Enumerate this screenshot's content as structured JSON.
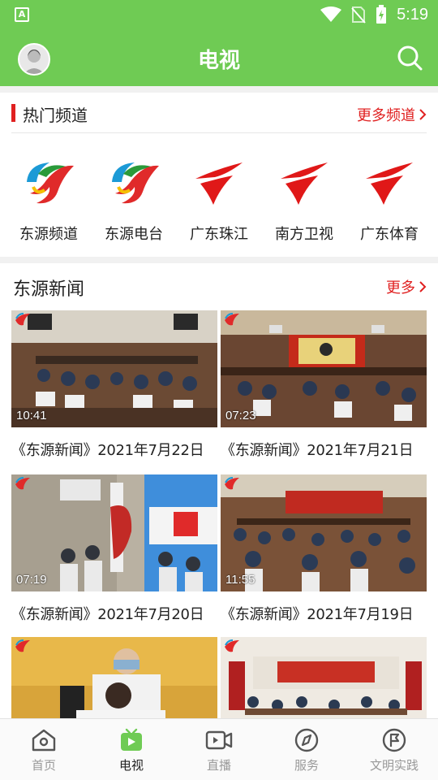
{
  "status_bar": {
    "time": "5:19",
    "app_badge": "A"
  },
  "app_bar": {
    "title": "电视"
  },
  "hot_channels": {
    "title": "热门频道",
    "more_label": "更多频道",
    "items": [
      {
        "name": "东源频道",
        "logo": "dongyuan-logo"
      },
      {
        "name": "东源电台",
        "logo": "dongyuan-logo"
      },
      {
        "name": "广东珠江",
        "logo": "guangdong-tv-logo"
      },
      {
        "name": "南方卫视",
        "logo": "guangdong-tv-logo"
      },
      {
        "name": "广东体育",
        "logo": "guangdong-tv-logo"
      }
    ]
  },
  "news": {
    "title": "东源新闻",
    "more_label": "更多",
    "videos": [
      {
        "title": "《东源新闻》2021年7月22日",
        "duration": "10:41"
      },
      {
        "title": "《东源新闻》2021年7月21日",
        "duration": "07:23"
      },
      {
        "title": "《东源新闻》2021年7月20日",
        "duration": "07:19"
      },
      {
        "title": "《东源新闻》2021年7月19日",
        "duration": "11:55"
      },
      {
        "title": "",
        "duration": ""
      },
      {
        "title": "",
        "duration": ""
      }
    ]
  },
  "bottom_nav": {
    "items": [
      {
        "label": "首页",
        "icon": "home-icon",
        "active": false
      },
      {
        "label": "电视",
        "icon": "tv-icon",
        "active": true
      },
      {
        "label": "直播",
        "icon": "live-icon",
        "active": false
      },
      {
        "label": "服务",
        "icon": "compass-icon",
        "active": false
      },
      {
        "label": "文明实践",
        "icon": "flag-icon",
        "active": false
      }
    ]
  },
  "colors": {
    "primary": "#6fcb54",
    "accent": "#e02020"
  }
}
